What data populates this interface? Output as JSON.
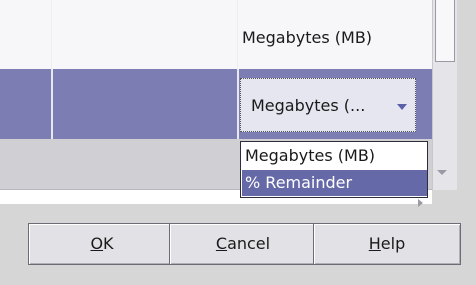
{
  "table": {
    "top_row_unit": "Megabytes (MB)",
    "selected_row_combo_value": "Megabytes (..."
  },
  "dropdown": {
    "options": [
      "Megabytes (MB)",
      "% Remainder"
    ],
    "highlighted": "% Remainder"
  },
  "buttons": {
    "ok": {
      "mnemonic": "O",
      "rest": "K"
    },
    "cancel": {
      "mnemonic": "C",
      "rest": "ancel"
    },
    "help": {
      "mnemonic": "H",
      "rest": "elp"
    }
  },
  "colors": {
    "selection": "#7b7db3",
    "highlight": "#6669a8"
  }
}
